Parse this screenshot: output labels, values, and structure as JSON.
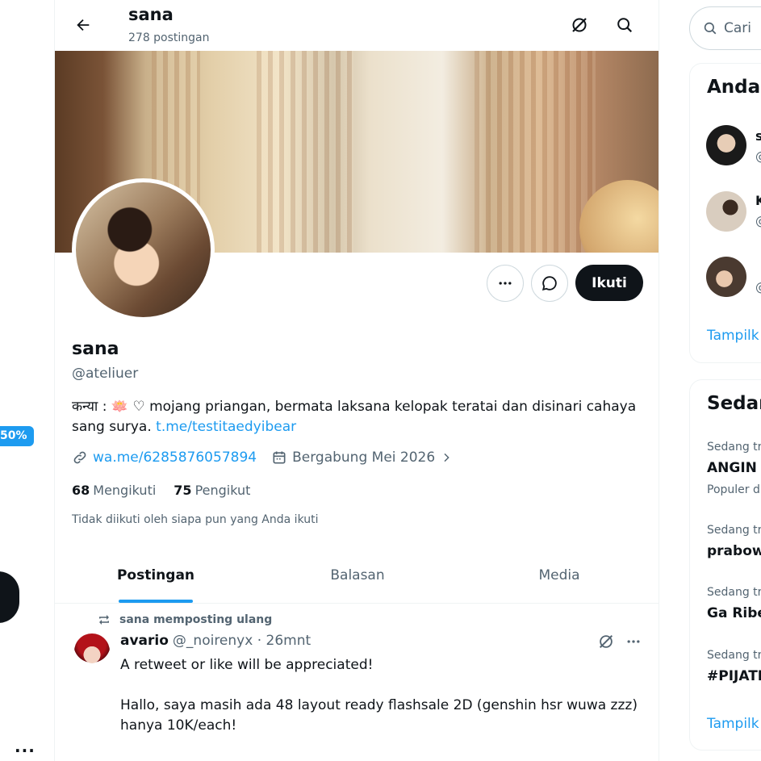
{
  "left_nav": {
    "badge": "50%",
    "more_label": "···"
  },
  "header": {
    "title": "sana",
    "post_count": "278 postingan"
  },
  "profile": {
    "name": "sana",
    "handle": "@ateliuer",
    "bio_text": "कन्या : 🪷 ♡ mojang priangan, bermata laksana kelopak teratai dan disinari cahaya sang surya.",
    "bio_link": "t.me/testitaedyibear",
    "website": "wa.me/6285876057894",
    "joined": "Bergabung Mei 2026",
    "following_count": "68",
    "following_label": "Mengikuti",
    "followers_count": "75",
    "followers_label": "Pengikut",
    "not_followed": "Tidak diikuti oleh siapa pun yang Anda ikuti",
    "follow_button": "Ikuti"
  },
  "tabs": [
    {
      "label": "Postingan",
      "active": true
    },
    {
      "label": "Balasan",
      "active": false
    },
    {
      "label": "Media",
      "active": false
    }
  ],
  "post": {
    "repost_label": "sana memposting ulang",
    "author_name": "avario",
    "author_handle_time": "@_noirenyx · 26mnt",
    "text_lines": [
      "A retweet or like will be appreciated!",
      "Hallo, saya masih ada 48 layout ready flashsale 2D (genshin hsr wuwa zzz) hanya 10K/each!"
    ]
  },
  "sidebar": {
    "search_placeholder": "Cari",
    "who_title": "Anda",
    "who": [
      {
        "short": "s",
        "at": "@"
      },
      {
        "short": "K",
        "at": "@"
      },
      {
        "short": "",
        "at": "@"
      }
    ],
    "show_more": "Tampilk",
    "trends_title": "Sedar",
    "trends": [
      {
        "label": "Sedang tr",
        "title": "ANGIN Y",
        "sub": "Populer d"
      },
      {
        "label": "Sedang tr",
        "title": "prabow",
        "sub": ""
      },
      {
        "label": "Sedang tr",
        "title": "Ga Ribe",
        "sub": ""
      },
      {
        "label": "Sedang tr",
        "title": "#PIJATI",
        "sub": ""
      }
    ],
    "trends_show_more": "Tampilk"
  },
  "colors": {
    "accent": "#1d9bf0",
    "text": "#0f1419",
    "muted": "#536471",
    "border": "#eff3f4"
  }
}
